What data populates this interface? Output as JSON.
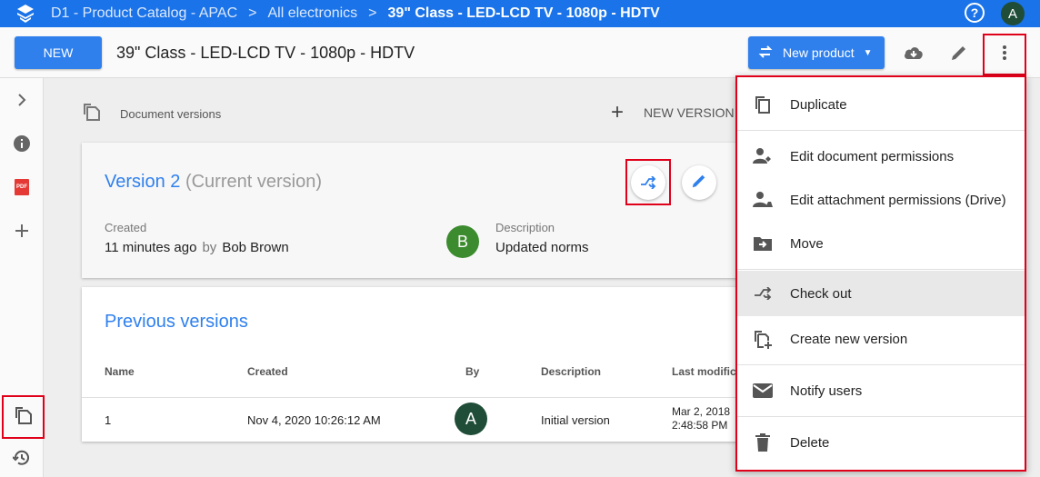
{
  "breadcrumb": {
    "items": [
      "D1 - Product Catalog - APAC",
      "All electronics",
      "39\" Class - LED-LCD TV - 1080p - HDTV"
    ],
    "separator": ">"
  },
  "top_user_initial": "A",
  "help_label": "?",
  "toolbar": {
    "new_label": "NEW",
    "doc_title": "39\" Class - LED-LCD TV - 1080p - HDTV",
    "new_product_label": "New product"
  },
  "versions": {
    "header": "Document versions",
    "new_version_label": "NEW VERSION",
    "current": {
      "title": "Version 2",
      "status": "(Current version)",
      "created_label": "Created",
      "created_value": "11 minutes ago",
      "by_label": "by",
      "by_value": "Bob Brown",
      "author_initial": "B",
      "description_label": "Description",
      "description_value": "Updated norms"
    },
    "previous": {
      "title": "Previous versions",
      "columns": [
        "Name",
        "Created",
        "By",
        "Description",
        "Last modifica"
      ],
      "rows": [
        {
          "name": "1",
          "created": "Nov 4, 2020 10:26:12 AM",
          "by_initial": "A",
          "description": "Initial version",
          "last_modified_1": "Mar 2, 2018",
          "last_modified_2": "2:48:58 PM"
        }
      ]
    }
  },
  "menu": {
    "items": [
      {
        "label": "Duplicate",
        "icon": "duplicate-icon"
      },
      {
        "label": "Edit document permissions",
        "icon": "person-permissions-icon"
      },
      {
        "label": "Edit attachment permissions (Drive)",
        "icon": "person-drive-icon"
      },
      {
        "label": "Move",
        "icon": "move-folder-icon"
      },
      {
        "label": "Check out",
        "icon": "check-out-icon"
      },
      {
        "label": "Create new version",
        "icon": "new-version-icon"
      },
      {
        "label": "Notify users",
        "icon": "mail-icon"
      },
      {
        "label": "Delete",
        "icon": "trash-icon"
      }
    ]
  },
  "rail": {
    "pdf_label": "PDF"
  },
  "colors": {
    "brand_blue": "#1a73e8",
    "button_blue": "#2f80ed",
    "highlight_red": "#e0001a"
  }
}
